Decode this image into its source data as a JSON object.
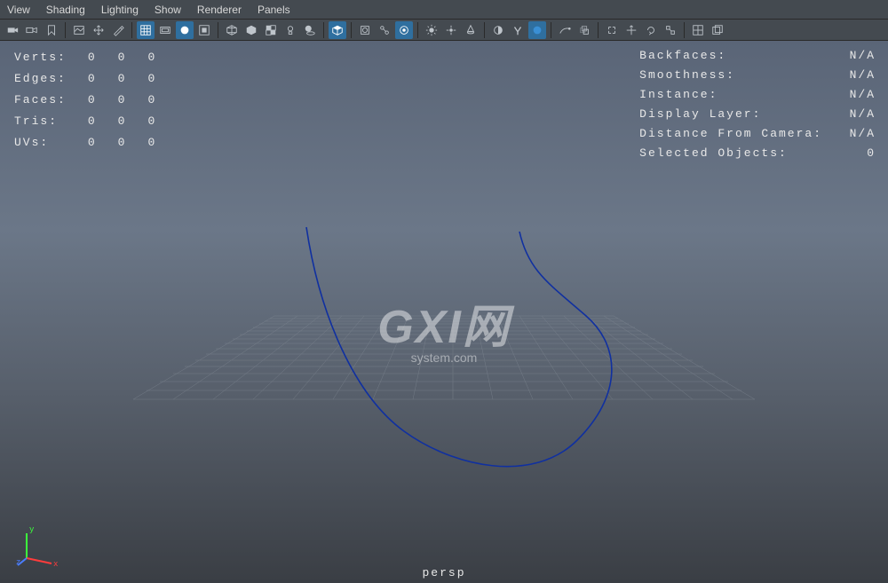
{
  "menu": {
    "items": [
      "View",
      "Shading",
      "Lighting",
      "Show",
      "Renderer",
      "Panels"
    ]
  },
  "hud_left": {
    "rows": [
      {
        "label": "Verts:",
        "a": "0",
        "b": "0",
        "c": "0"
      },
      {
        "label": "Edges:",
        "a": "0",
        "b": "0",
        "c": "0"
      },
      {
        "label": "Faces:",
        "a": "0",
        "b": "0",
        "c": "0"
      },
      {
        "label": "Tris:",
        "a": "0",
        "b": "0",
        "c": "0"
      },
      {
        "label": "UVs:",
        "a": "0",
        "b": "0",
        "c": "0"
      }
    ]
  },
  "hud_right": {
    "rows": [
      {
        "label": "Backfaces:",
        "value": "N/A"
      },
      {
        "label": "Smoothness:",
        "value": "N/A"
      },
      {
        "label": "Instance:",
        "value": "N/A"
      },
      {
        "label": "Display Layer:",
        "value": "N/A"
      },
      {
        "label": "Distance From Camera:",
        "value": "N/A"
      },
      {
        "label": "Selected Objects:",
        "value": "0"
      }
    ]
  },
  "camera": {
    "label": "persp"
  },
  "watermark": {
    "big": "GXI网",
    "small": "system.com"
  },
  "axis": {
    "x": "x",
    "y": "y",
    "z": "z"
  },
  "toolbar_icons": [
    "select-camera-icon",
    "camera-icon",
    "bookmark-icon",
    "sep",
    "image-plane-icon",
    "2d-pan-icon",
    "grease-pencil-icon",
    "sep",
    "grid-icon",
    "film-gate-icon",
    "resolution-gate-icon",
    "gate-mask-icon",
    "sep",
    "wireframe-icon",
    "shaded-icon",
    "textured-icon",
    "lights-icon",
    "shadows-icon",
    "sep",
    "isolate-select-icon",
    "sep",
    "xray-icon",
    "xray-joints-icon",
    "sep",
    "renderer-icon",
    "sep",
    "sun-icon",
    "point-light-icon",
    "spot-light-icon",
    "sep",
    "exposure-icon",
    "gamma-icon",
    "color-mgmt-icon",
    "sep",
    "motion-trail-icon",
    "ghosting-icon",
    "sep",
    "snap-icon",
    "translate-icon",
    "rotate-icon",
    "scale-icon",
    "sep",
    "layout-icon",
    "tear-off-icon"
  ]
}
